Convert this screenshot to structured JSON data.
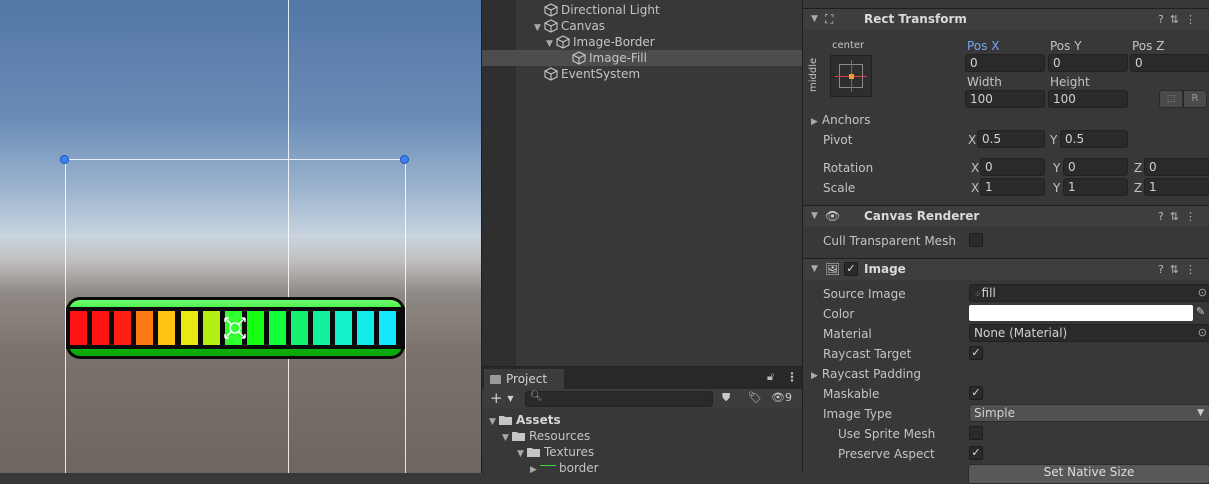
{
  "scene": {
    "segment_colors": [
      "#ff1414",
      "#ff1414",
      "#ff1f14",
      "#ff7a12",
      "#ffc414",
      "#e8e814",
      "#b4f014",
      "#30ff30",
      "#14ff14",
      "#14ff3c",
      "#14f070",
      "#14f0a0",
      "#14f0c8",
      "#14ecec",
      "#14e6ff"
    ]
  },
  "hierarchy": {
    "items": [
      {
        "label": "Directional Light"
      },
      {
        "label": "Canvas"
      },
      {
        "label": "Image-Border"
      },
      {
        "label": "Image-Fill"
      },
      {
        "label": "EventSystem"
      }
    ]
  },
  "project": {
    "tab_label": "Project",
    "hidden_count": "9",
    "tree": [
      {
        "label": "Assets"
      },
      {
        "label": "Resources"
      },
      {
        "label": "Textures"
      },
      {
        "label": "border"
      }
    ]
  },
  "inspector": {
    "rect_transform": {
      "title": "Rect Transform",
      "anchor_h": "center",
      "anchor_v": "middle",
      "pos_x_label": "Pos X",
      "pos_y_label": "Pos Y",
      "pos_z_label": "Pos Z",
      "pos_x": "0",
      "pos_y": "0",
      "pos_z": "0",
      "width_label": "Width",
      "height_label": "Height",
      "width": "100",
      "height": "100",
      "r_button": "R",
      "anchors_label": "Anchors",
      "pivot_label": "Pivot",
      "pivot_x": "0.5",
      "pivot_y": "0.5",
      "rotation_label": "Rotation",
      "rot_x": "0",
      "rot_y": "0",
      "rot_z": "0",
      "scale_label": "Scale",
      "scale_x": "1",
      "scale_y": "1",
      "scale_z": "1",
      "axis_x": "X",
      "axis_y": "Y",
      "axis_z": "Z"
    },
    "canvas_renderer": {
      "title": "Canvas Renderer",
      "cull_label": "Cull Transparent Mesh"
    },
    "image": {
      "title": "Image",
      "source_image_label": "Source Image",
      "source_image": "fill",
      "color_label": "Color",
      "color_value": "#ffffff",
      "material_label": "Material",
      "material": "None (Material)",
      "raycast_target_label": "Raycast Target",
      "raycast_padding_label": "Raycast Padding",
      "maskable_label": "Maskable",
      "image_type_label": "Image Type",
      "image_type": "Simple",
      "use_sprite_mesh_label": "Use Sprite Mesh",
      "preserve_aspect_label": "Preserve Aspect",
      "set_native_size": "Set Native Size"
    }
  }
}
